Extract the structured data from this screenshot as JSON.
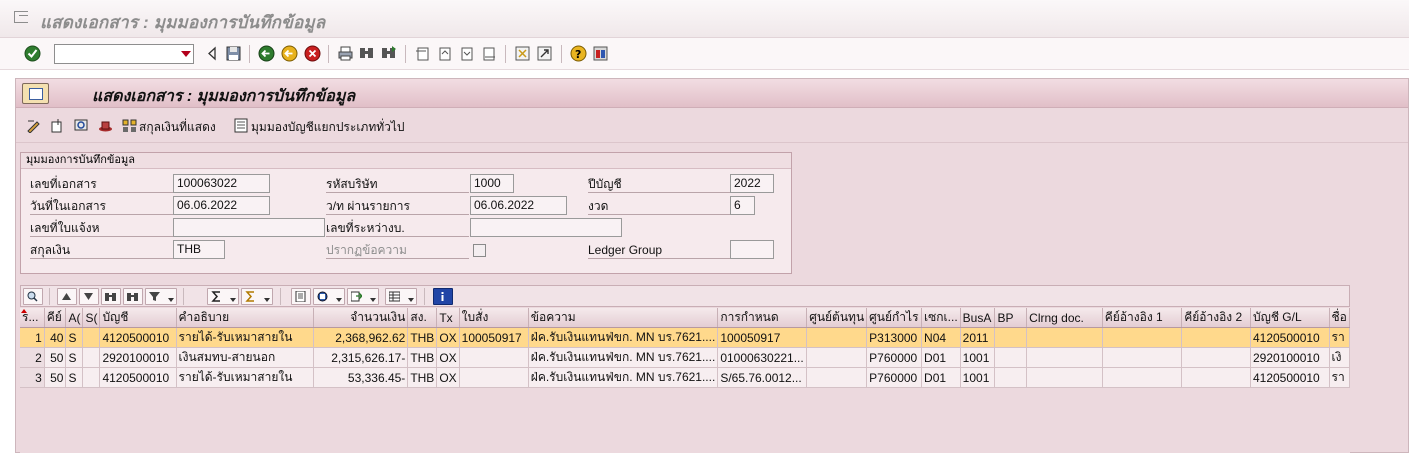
{
  "window": {
    "title": "แสดงเอกสาร : มุมมองการบันทึกข้อมูล"
  },
  "toolbar": {
    "command_value": ""
  },
  "panel": {
    "title": "แสดงเอกสาร : มุมมองการบันทึกข้อมูล",
    "buttons": {
      "display_currency": "สกุลเงินที่แสดง",
      "gl_view": "มุมมองบัญชีแยกประเภททั่วไป"
    }
  },
  "entry_view": {
    "title": "มุมมองการบันทึกข้อมูล",
    "doc_no_label": "เลขที่เอกสาร",
    "doc_no": "100063022",
    "company_label": "รหัสบริษัท",
    "company": "1000",
    "fiscal_year_label": "ปีบัญชี",
    "fiscal_year": "2022",
    "doc_date_label": "วันที่ในเอกสาร",
    "doc_date": "06.06.2022",
    "posting_date_label": "ว/ท ผ่านรายการ",
    "posting_date": "06.06.2022",
    "period_label": "งวด",
    "period": "6",
    "reference_label": "เลขที่ใบแจ้งห",
    "reference": "",
    "cross_cc_label": "เลขที่ระหว่างบ.",
    "cross_cc": "",
    "currency_label": "สกุลเงิน",
    "currency": "THB",
    "texts_exist_label": "ปรากฏข้อความ",
    "ledger_group_label": "Ledger Group",
    "ledger_group": ""
  },
  "table": {
    "headers": [
      "ร...",
      "คีย์",
      "A(",
      "S(",
      "บัญชี",
      "คำอธิบาย",
      "จำนวนเงิน",
      "สง.",
      "Tx",
      "ใบสั่ง",
      "ข้อความ",
      "การกำหนด",
      "ศูนย์ต้นทุน",
      "ศูนย์กำไร",
      "เซกเ...",
      "BusA",
      "BP",
      "Clrng doc.",
      "คีย์อ้างอิง 1",
      "คีย์อ้างอิง 2",
      "บัญชี G/L",
      "ชื่อ"
    ],
    "rows": [
      [
        "1",
        "40",
        "S",
        "",
        "4120500010",
        "รายได้-รับเหมาสายใน",
        "2,368,962.62",
        "THB",
        "OX",
        "100050917",
        "ฝ่ค.รับเงินแทนฟ่ขก. MN บร.7621....",
        "100050917",
        "",
        "P313000",
        "N04",
        "2011",
        "",
        "",
        "",
        "",
        "4120500010",
        "รา"
      ],
      [
        "2",
        "50",
        "S",
        "",
        "2920100010",
        "เงินสมทบ-สายนอก",
        "2,315,626.17-",
        "THB",
        "OX",
        "",
        "ฝ่ค.รับเงินแทนฟ่ขก. MN บร.7621....",
        "01000630221...",
        "",
        "P760000",
        "D01",
        "1001",
        "",
        "",
        "",
        "",
        "2920100010",
        "เงิ"
      ],
      [
        "3",
        "50",
        "S",
        "",
        "4120500010",
        "รายได้-รับเหมาสายใน",
        "53,336.45-",
        "THB",
        "OX",
        "",
        "ฝ่ค.รับเงินแทนฟ่ขก. MN บร.7621....",
        "S/65.76.0012...",
        "",
        "P760000",
        "D01",
        "1001",
        "",
        "",
        "",
        "",
        "4120500010",
        "รา"
      ]
    ]
  }
}
